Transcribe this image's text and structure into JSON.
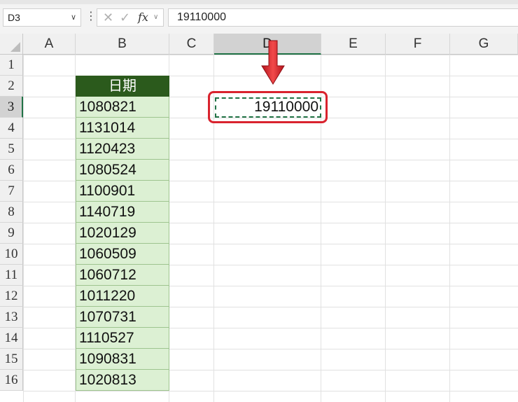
{
  "formula_bar": {
    "name_box": "D3",
    "formula": "19110000",
    "fx_label": "fx"
  },
  "columns": [
    "A",
    "B",
    "C",
    "D",
    "E",
    "F",
    "G"
  ],
  "selected_column": "D",
  "rows": [
    "1",
    "2",
    "3",
    "4",
    "5",
    "6",
    "7",
    "8",
    "9",
    "10",
    "11",
    "12",
    "13",
    "14",
    "15",
    "16"
  ],
  "selected_row": "3",
  "sheet": {
    "header_cell": "日期",
    "dates": [
      "1080821",
      "1131014",
      "1120423",
      "1080524",
      "1100901",
      "1140719",
      "1020129",
      "1060509",
      "1060712",
      "1011220",
      "1070731",
      "1110527",
      "1090831",
      "1020813"
    ],
    "d3_value": "19110000"
  },
  "colors": {
    "header_fill": "#2b5a1c",
    "data_fill": "#dcf0d3",
    "highlight": "#d9232e",
    "selection": "#217346"
  }
}
